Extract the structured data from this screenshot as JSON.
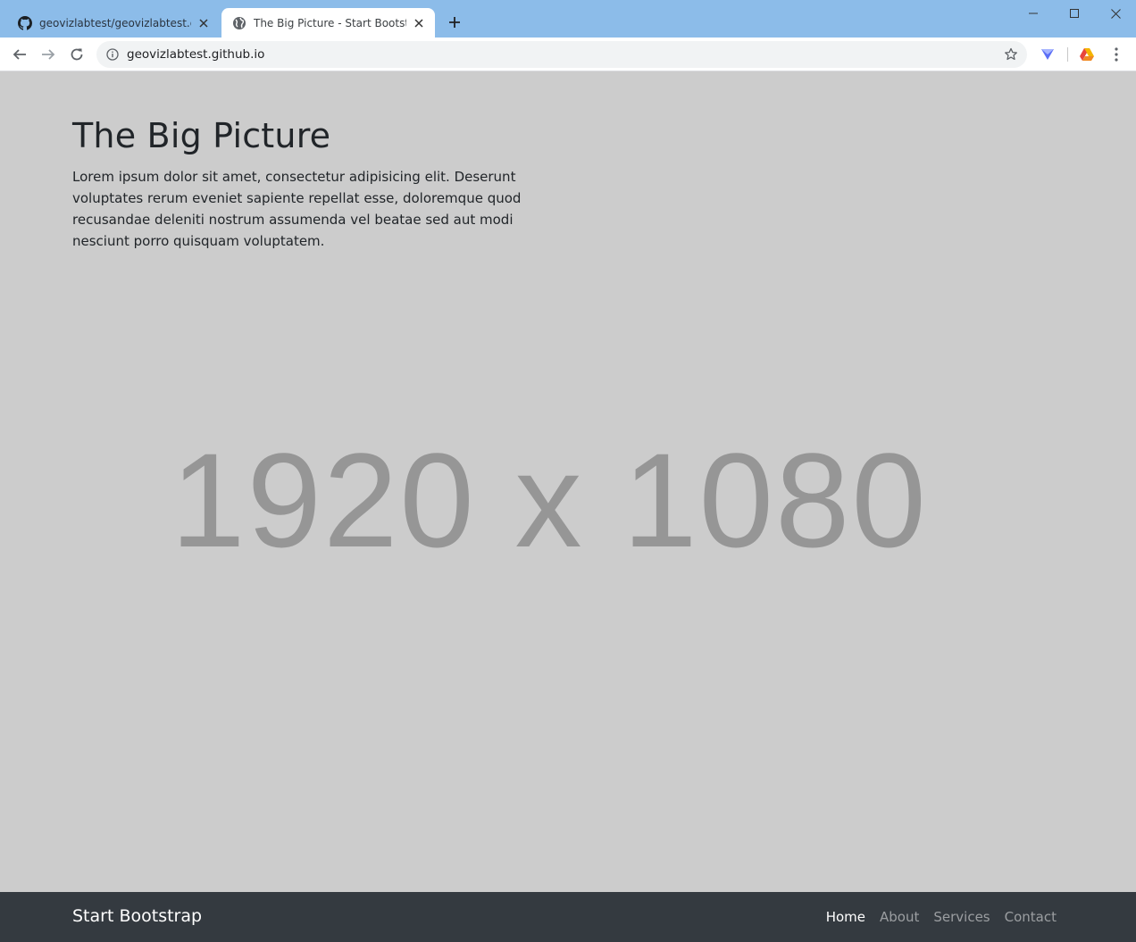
{
  "browser": {
    "tabs": [
      {
        "title": "geovizlabtest/geovizlabtest.github.io",
        "icon": "github-icon",
        "active": false
      },
      {
        "title": "The Big Picture - Start Bootstrap Template",
        "icon": "globe-icon",
        "active": true
      }
    ],
    "new_tab_label": "+",
    "url": "geovizlabtest.github.io"
  },
  "page": {
    "heading": "The Big Picture",
    "lead": "Lorem ipsum dolor sit amet, consectetur adipisicing elit. Deserunt voluptates rerum eveniet sapiente repellat esse, doloremque quod recusandae deleniti nostrum assumenda vel beatae sed aut modi nesciunt porro quisquam voluptatem.",
    "placeholder": "1920 x 1080"
  },
  "navbar": {
    "brand": "Start Bootstrap",
    "links": [
      {
        "label": "Home",
        "active": true
      },
      {
        "label": "About",
        "active": false
      },
      {
        "label": "Services",
        "active": false
      },
      {
        "label": "Contact",
        "active": false
      }
    ]
  },
  "colors": {
    "tabstrip": "#8cbce9",
    "page_background": "#cccccc",
    "placeholder_text": "#969696",
    "navbar_background": "#343a40"
  }
}
